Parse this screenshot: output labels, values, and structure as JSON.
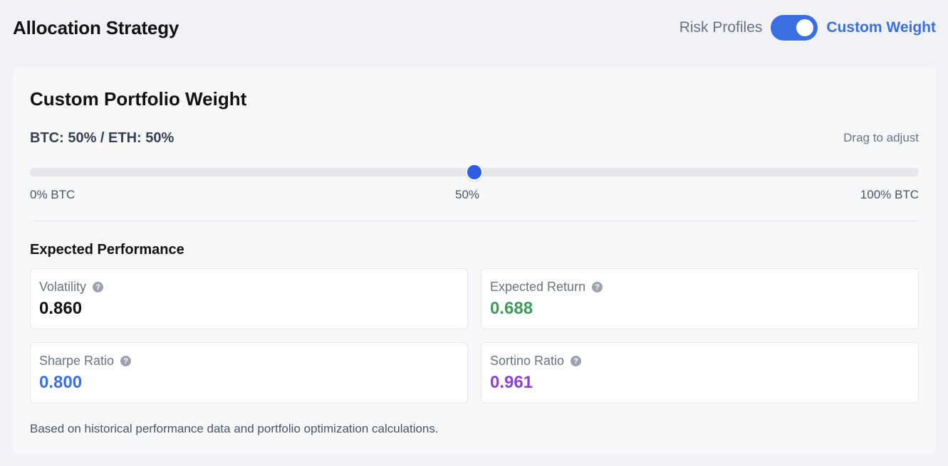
{
  "header": {
    "title": "Allocation Strategy",
    "mode_left": "Risk Profiles",
    "mode_right": "Custom Weight",
    "toggle_on": true,
    "accent_color": "#3b6ee0"
  },
  "card": {
    "title": "Custom Portfolio Weight",
    "ratio_text": "BTC: 50% / ETH: 50%",
    "drag_hint": "Drag to adjust",
    "slider": {
      "value_percent": 50,
      "min_label": "0% BTC",
      "mid_label": "50%",
      "max_label": "100% BTC"
    },
    "performance_title": "Expected Performance",
    "metrics": [
      {
        "label": "Volatility",
        "value": "0.860",
        "color": "#111111",
        "icon": "help-icon"
      },
      {
        "label": "Expected Return",
        "value": "0.688",
        "color": "#3f9a5c",
        "icon": "help-icon"
      },
      {
        "label": "Sharpe Ratio",
        "value": "0.800",
        "color": "#3b6ee0",
        "icon": "help-icon"
      },
      {
        "label": "Sortino Ratio",
        "value": "0.961",
        "color": "#8b3fd6",
        "icon": "help-icon"
      }
    ],
    "footnote": "Based on historical performance data and portfolio optimization calculations."
  }
}
